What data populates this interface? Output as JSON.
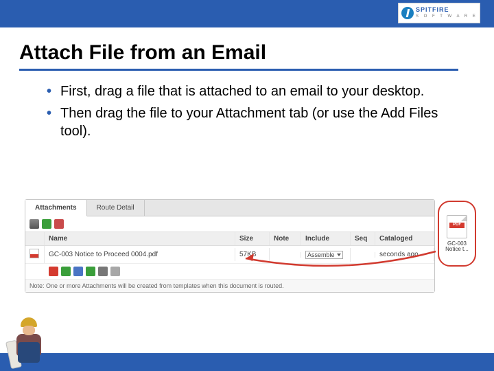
{
  "logo": {
    "brand": "SPITFIRE",
    "subtitle": "S O F T W A R E"
  },
  "title": "Attach File from an Email",
  "bullets": [
    "First, drag a file that is attached to an email to your desktop.",
    "Then drag the file to your Attachment tab (or use the Add Files tool)."
  ],
  "panel": {
    "tabs": {
      "active": "Attachments",
      "inactive": "Route Detail"
    },
    "columns": {
      "name": "Name",
      "size": "Size",
      "note": "Note",
      "include": "Include",
      "seq": "Seq",
      "cat": "Cataloged"
    },
    "row": {
      "name": "GC-003 Notice to Proceed 0004.pdf",
      "size": "57KB",
      "note": "",
      "include": "Assemble",
      "seq": "",
      "cat": "seconds ago"
    },
    "note": "Note: One or more Attachments will be created from templates when this document is routed."
  },
  "file": {
    "line1": "GC-003",
    "line2": "Notice t..."
  }
}
